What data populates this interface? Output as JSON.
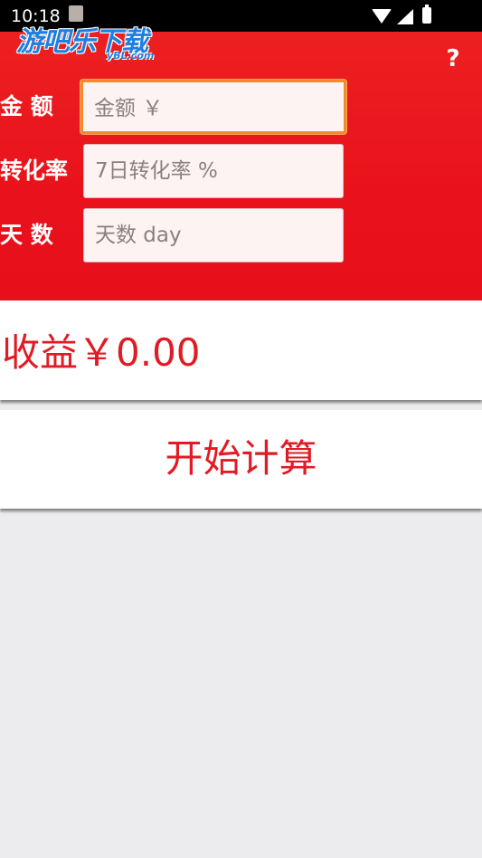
{
  "status_bar": {
    "time": "10:18"
  },
  "watermark": {
    "text": "游吧乐下载",
    "sub": "yBL.com"
  },
  "header": {
    "help_label": "?"
  },
  "form": {
    "amount": {
      "label": "金 额",
      "placeholder": "金额 ￥"
    },
    "conversion_rate": {
      "label": "转化率",
      "placeholder": "7日转化率 %"
    },
    "days": {
      "label": "天 数",
      "placeholder": "天数 day"
    }
  },
  "result": {
    "text": "收益￥0.00"
  },
  "calculate": {
    "label": "开始计算"
  },
  "colors": {
    "header_red": "#e9121c",
    "accent_red": "#e21a24",
    "focus_orange": "#f58a2a",
    "page_background": "#ececee"
  },
  "icons": [
    "wifi-icon",
    "signal-icon",
    "battery-icon",
    "notification-thumbnail-icon",
    "help-icon"
  ]
}
